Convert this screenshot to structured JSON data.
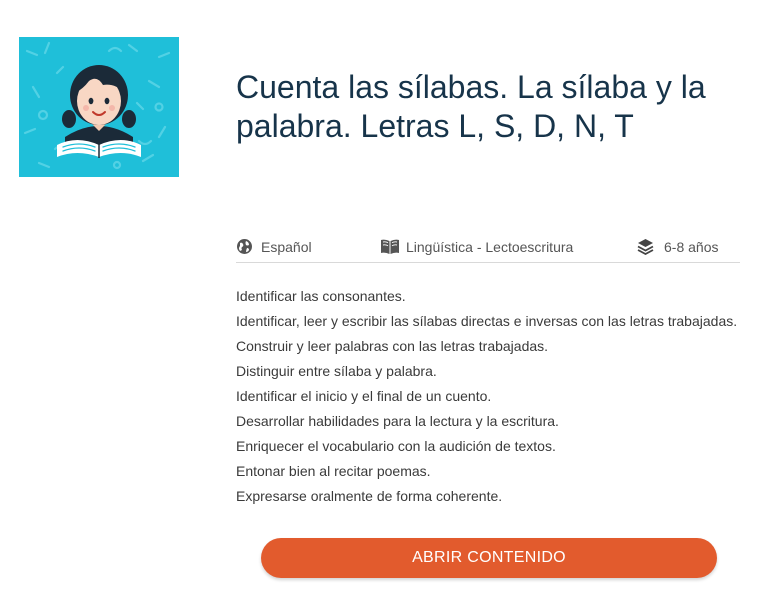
{
  "thumbnail": {
    "icon": "child-reading-book-illustration",
    "background_color": "#1fbfd9"
  },
  "title": "Cuenta las sílabas. La sílaba y la palabra. Letras L, S, D, N, T",
  "meta": {
    "language": {
      "icon": "globe-icon",
      "label": "Español"
    },
    "area": {
      "icon": "book-icon",
      "label": "Lingüística - Lectoescritura"
    },
    "age": {
      "icon": "layers-icon",
      "label": "6-8 años"
    }
  },
  "objectives": [
    "Identificar las consonantes.",
    "Identificar, leer y escribir las sílabas directas e inversas con las letras trabajadas.",
    "Construir y leer palabras con las letras trabajadas.",
    "Distinguir entre sílaba y palabra.",
    "Identificar el inicio y el final de un cuento.",
    "Desarrollar habilidades para la lectura y la escritura.",
    "Enriquecer el vocabulario con la audición de textos.",
    "Entonar bien al recitar poemas.",
    "Expresarse oralmente de forma coherente."
  ],
  "open_button": {
    "label": "ABRIR CONTENIDO",
    "color": "#e25b2d"
  }
}
